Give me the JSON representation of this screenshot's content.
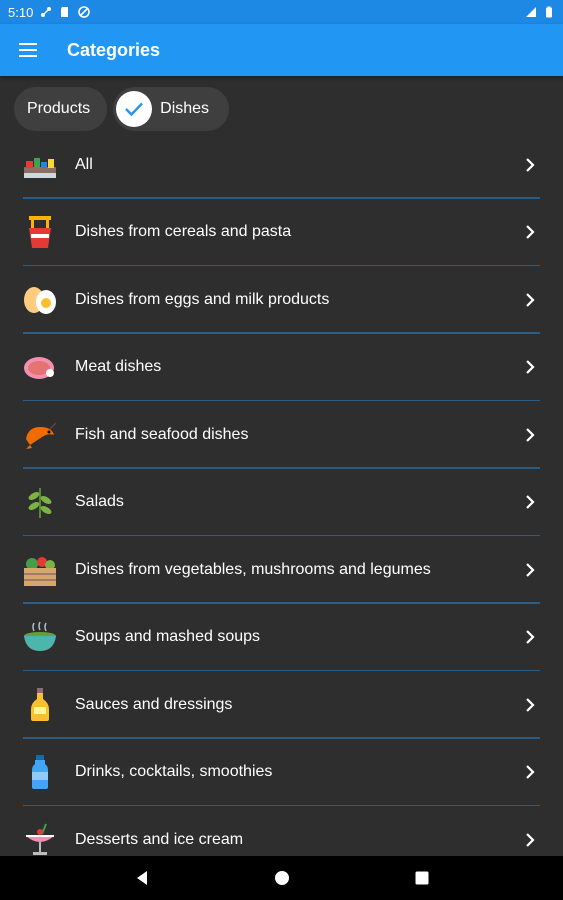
{
  "status_bar": {
    "time": "5:10"
  },
  "app_bar": {
    "title": "Categories",
    "menu_icon": "hamburger-menu-icon"
  },
  "chips": [
    {
      "label": "Products",
      "selected": false
    },
    {
      "label": "Dishes",
      "selected": true
    }
  ],
  "colors": {
    "accent": "#2196f3",
    "status_bar": "#1e88e5",
    "background": "#2e2e2e",
    "divider": "#2b5d85"
  },
  "categories": [
    {
      "label": "All",
      "icon": "all-dishes-icon"
    },
    {
      "label": "Dishes from cereals and pasta",
      "icon": "noodles-icon"
    },
    {
      "label": "Dishes from eggs and milk products",
      "icon": "eggs-icon"
    },
    {
      "label": "Meat dishes",
      "icon": "meat-icon"
    },
    {
      "label": "Fish and seafood dishes",
      "icon": "shrimp-icon"
    },
    {
      "label": "Salads",
      "icon": "herb-icon"
    },
    {
      "label": "Dishes from vegetables, mushrooms and legumes",
      "icon": "vegetable-crate-icon"
    },
    {
      "label": "Soups and mashed soups",
      "icon": "soup-bowl-icon"
    },
    {
      "label": "Sauces and dressings",
      "icon": "oil-bottle-icon"
    },
    {
      "label": "Drinks, cocktails, smoothies",
      "icon": "water-bottle-icon"
    },
    {
      "label": "Desserts and ice cream",
      "icon": "ice-cream-icon"
    }
  ]
}
